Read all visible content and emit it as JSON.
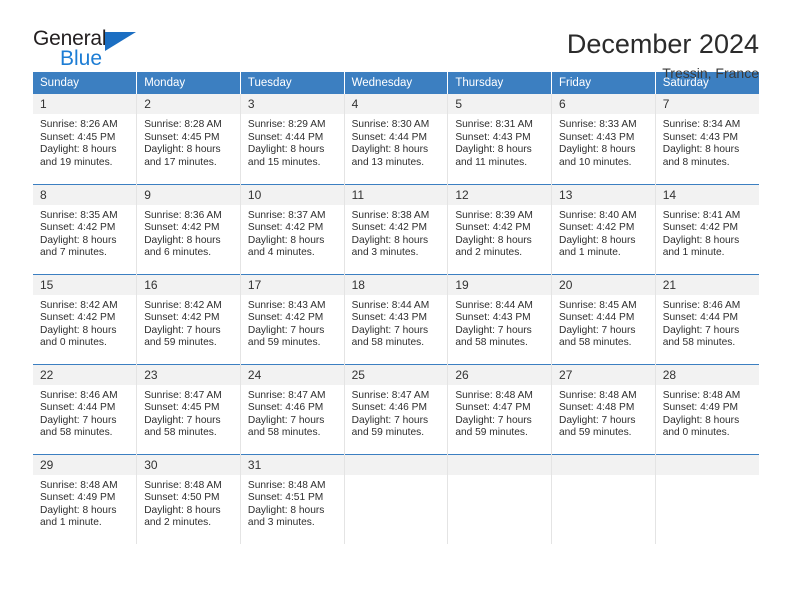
{
  "logo": {
    "part1": "General",
    "part2": "Blue",
    "triangle": "blue-triangle-icon",
    "color_dark": "#231f20",
    "color_blue": "#1d7dd4"
  },
  "header": {
    "title": "December 2024",
    "subtitle": "Tressin, France"
  },
  "theme": {
    "header_bg": "#3c7fc1",
    "daynum_bg": "#f2f2f2",
    "divider": "#3c7fc1",
    "cell_border": "#e4e4e4"
  },
  "calendar": {
    "day_names": [
      "Sunday",
      "Monday",
      "Tuesday",
      "Wednesday",
      "Thursday",
      "Friday",
      "Saturday"
    ],
    "weeks": [
      [
        {
          "day": "1",
          "sunrise": "Sunrise: 8:26 AM",
          "sunset": "Sunset: 4:45 PM",
          "daylight1": "Daylight: 8 hours",
          "daylight2": "and 19 minutes."
        },
        {
          "day": "2",
          "sunrise": "Sunrise: 8:28 AM",
          "sunset": "Sunset: 4:45 PM",
          "daylight1": "Daylight: 8 hours",
          "daylight2": "and 17 minutes."
        },
        {
          "day": "3",
          "sunrise": "Sunrise: 8:29 AM",
          "sunset": "Sunset: 4:44 PM",
          "daylight1": "Daylight: 8 hours",
          "daylight2": "and 15 minutes."
        },
        {
          "day": "4",
          "sunrise": "Sunrise: 8:30 AM",
          "sunset": "Sunset: 4:44 PM",
          "daylight1": "Daylight: 8 hours",
          "daylight2": "and 13 minutes."
        },
        {
          "day": "5",
          "sunrise": "Sunrise: 8:31 AM",
          "sunset": "Sunset: 4:43 PM",
          "daylight1": "Daylight: 8 hours",
          "daylight2": "and 11 minutes."
        },
        {
          "day": "6",
          "sunrise": "Sunrise: 8:33 AM",
          "sunset": "Sunset: 4:43 PM",
          "daylight1": "Daylight: 8 hours",
          "daylight2": "and 10 minutes."
        },
        {
          "day": "7",
          "sunrise": "Sunrise: 8:34 AM",
          "sunset": "Sunset: 4:43 PM",
          "daylight1": "Daylight: 8 hours",
          "daylight2": "and 8 minutes."
        }
      ],
      [
        {
          "day": "8",
          "sunrise": "Sunrise: 8:35 AM",
          "sunset": "Sunset: 4:42 PM",
          "daylight1": "Daylight: 8 hours",
          "daylight2": "and 7 minutes."
        },
        {
          "day": "9",
          "sunrise": "Sunrise: 8:36 AM",
          "sunset": "Sunset: 4:42 PM",
          "daylight1": "Daylight: 8 hours",
          "daylight2": "and 6 minutes."
        },
        {
          "day": "10",
          "sunrise": "Sunrise: 8:37 AM",
          "sunset": "Sunset: 4:42 PM",
          "daylight1": "Daylight: 8 hours",
          "daylight2": "and 4 minutes."
        },
        {
          "day": "11",
          "sunrise": "Sunrise: 8:38 AM",
          "sunset": "Sunset: 4:42 PM",
          "daylight1": "Daylight: 8 hours",
          "daylight2": "and 3 minutes."
        },
        {
          "day": "12",
          "sunrise": "Sunrise: 8:39 AM",
          "sunset": "Sunset: 4:42 PM",
          "daylight1": "Daylight: 8 hours",
          "daylight2": "and 2 minutes."
        },
        {
          "day": "13",
          "sunrise": "Sunrise: 8:40 AM",
          "sunset": "Sunset: 4:42 PM",
          "daylight1": "Daylight: 8 hours",
          "daylight2": "and 1 minute."
        },
        {
          "day": "14",
          "sunrise": "Sunrise: 8:41 AM",
          "sunset": "Sunset: 4:42 PM",
          "daylight1": "Daylight: 8 hours",
          "daylight2": "and 1 minute."
        }
      ],
      [
        {
          "day": "15",
          "sunrise": "Sunrise: 8:42 AM",
          "sunset": "Sunset: 4:42 PM",
          "daylight1": "Daylight: 8 hours",
          "daylight2": "and 0 minutes."
        },
        {
          "day": "16",
          "sunrise": "Sunrise: 8:42 AM",
          "sunset": "Sunset: 4:42 PM",
          "daylight1": "Daylight: 7 hours",
          "daylight2": "and 59 minutes."
        },
        {
          "day": "17",
          "sunrise": "Sunrise: 8:43 AM",
          "sunset": "Sunset: 4:42 PM",
          "daylight1": "Daylight: 7 hours",
          "daylight2": "and 59 minutes."
        },
        {
          "day": "18",
          "sunrise": "Sunrise: 8:44 AM",
          "sunset": "Sunset: 4:43 PM",
          "daylight1": "Daylight: 7 hours",
          "daylight2": "and 58 minutes."
        },
        {
          "day": "19",
          "sunrise": "Sunrise: 8:44 AM",
          "sunset": "Sunset: 4:43 PM",
          "daylight1": "Daylight: 7 hours",
          "daylight2": "and 58 minutes."
        },
        {
          "day": "20",
          "sunrise": "Sunrise: 8:45 AM",
          "sunset": "Sunset: 4:44 PM",
          "daylight1": "Daylight: 7 hours",
          "daylight2": "and 58 minutes."
        },
        {
          "day": "21",
          "sunrise": "Sunrise: 8:46 AM",
          "sunset": "Sunset: 4:44 PM",
          "daylight1": "Daylight: 7 hours",
          "daylight2": "and 58 minutes."
        }
      ],
      [
        {
          "day": "22",
          "sunrise": "Sunrise: 8:46 AM",
          "sunset": "Sunset: 4:44 PM",
          "daylight1": "Daylight: 7 hours",
          "daylight2": "and 58 minutes."
        },
        {
          "day": "23",
          "sunrise": "Sunrise: 8:47 AM",
          "sunset": "Sunset: 4:45 PM",
          "daylight1": "Daylight: 7 hours",
          "daylight2": "and 58 minutes."
        },
        {
          "day": "24",
          "sunrise": "Sunrise: 8:47 AM",
          "sunset": "Sunset: 4:46 PM",
          "daylight1": "Daylight: 7 hours",
          "daylight2": "and 58 minutes."
        },
        {
          "day": "25",
          "sunrise": "Sunrise: 8:47 AM",
          "sunset": "Sunset: 4:46 PM",
          "daylight1": "Daylight: 7 hours",
          "daylight2": "and 59 minutes."
        },
        {
          "day": "26",
          "sunrise": "Sunrise: 8:48 AM",
          "sunset": "Sunset: 4:47 PM",
          "daylight1": "Daylight: 7 hours",
          "daylight2": "and 59 minutes."
        },
        {
          "day": "27",
          "sunrise": "Sunrise: 8:48 AM",
          "sunset": "Sunset: 4:48 PM",
          "daylight1": "Daylight: 7 hours",
          "daylight2": "and 59 minutes."
        },
        {
          "day": "28",
          "sunrise": "Sunrise: 8:48 AM",
          "sunset": "Sunset: 4:49 PM",
          "daylight1": "Daylight: 8 hours",
          "daylight2": "and 0 minutes."
        }
      ],
      [
        {
          "day": "29",
          "sunrise": "Sunrise: 8:48 AM",
          "sunset": "Sunset: 4:49 PM",
          "daylight1": "Daylight: 8 hours",
          "daylight2": "and 1 minute."
        },
        {
          "day": "30",
          "sunrise": "Sunrise: 8:48 AM",
          "sunset": "Sunset: 4:50 PM",
          "daylight1": "Daylight: 8 hours",
          "daylight2": "and 2 minutes."
        },
        {
          "day": "31",
          "sunrise": "Sunrise: 8:48 AM",
          "sunset": "Sunset: 4:51 PM",
          "daylight1": "Daylight: 8 hours",
          "daylight2": "and 3 minutes."
        },
        {
          "day": "",
          "sunrise": "",
          "sunset": "",
          "daylight1": "",
          "daylight2": ""
        },
        {
          "day": "",
          "sunrise": "",
          "sunset": "",
          "daylight1": "",
          "daylight2": ""
        },
        {
          "day": "",
          "sunrise": "",
          "sunset": "",
          "daylight1": "",
          "daylight2": ""
        },
        {
          "day": "",
          "sunrise": "",
          "sunset": "",
          "daylight1": "",
          "daylight2": ""
        }
      ]
    ]
  }
}
